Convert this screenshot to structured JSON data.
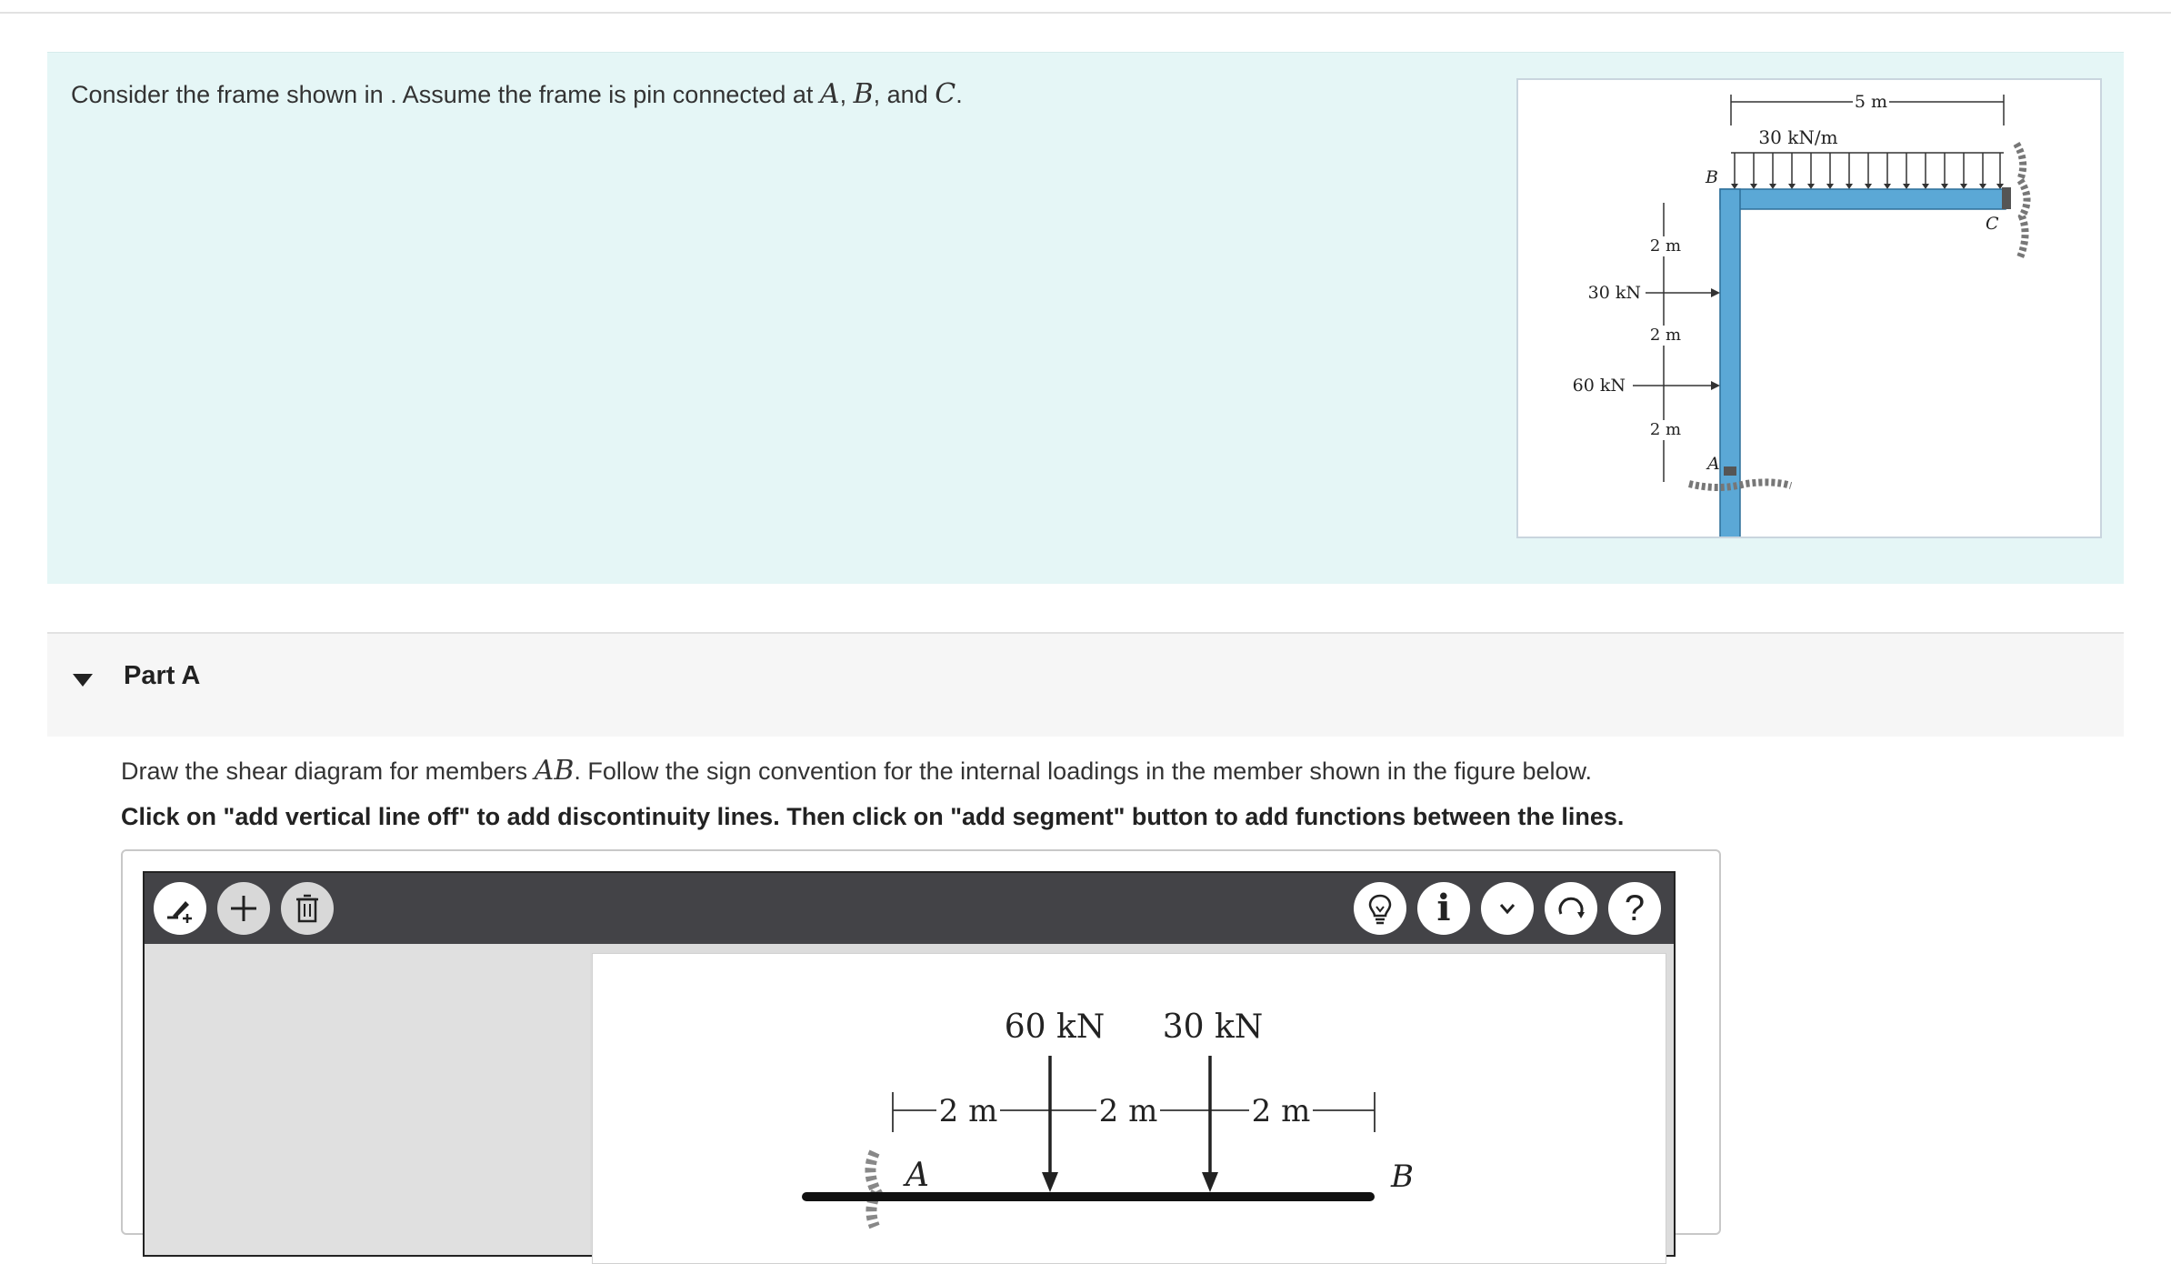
{
  "problem": {
    "intro_before": "Consider the frame shown in . Assume the frame is pin connected at ",
    "point_a": "A",
    "sep1": ", ",
    "point_b": "B",
    "sep2": ", and ",
    "point_c": "C",
    "end": "."
  },
  "frame_figure": {
    "span_label": "5 m",
    "distributed_load": "30 kN/m",
    "label_b": "B",
    "label_c": "C",
    "label_a": "A",
    "dim_1": "2 m",
    "dim_2": "2 m",
    "dim_3": "2 m",
    "force_upper": "30 kN",
    "force_lower": "60 kN"
  },
  "part": {
    "title": "Part A"
  },
  "instructions": {
    "line1_before": "Draw the shear diagram for members ",
    "member": "AB",
    "line1_after": ". Follow the sign convention for the internal loadings in the member shown in the figure below.",
    "line2": "Click on \"add vertical line off\" to add discontinuity lines. Then click on \"add segment\" button to add functions between the lines."
  },
  "toolbar": {
    "buttons": [
      "draw-tool",
      "add",
      "delete",
      "hint",
      "info",
      "more",
      "reset",
      "help"
    ],
    "help_glyph": "?",
    "info_glyph": "i"
  },
  "beam_figure": {
    "load_1": "60 kN",
    "load_2": "30 kN",
    "dim_1": "2 m",
    "dim_2": "2 m",
    "dim_3": "2 m",
    "label_a": "A",
    "label_b": "B"
  }
}
